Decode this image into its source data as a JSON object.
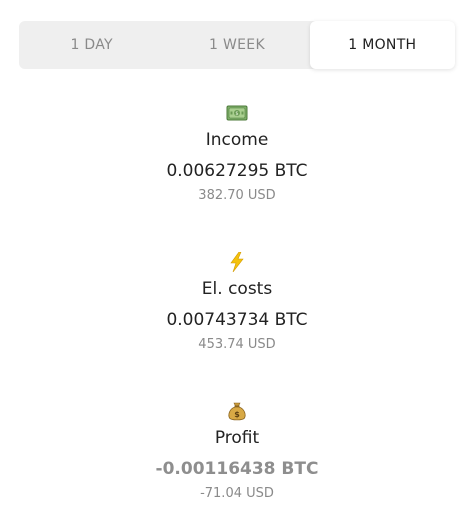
{
  "tabs": [
    {
      "label": "1 DAY",
      "active": false
    },
    {
      "label": "1 WEEK",
      "active": false
    },
    {
      "label": "1 MONTH",
      "active": true
    }
  ],
  "stats": {
    "income": {
      "icon": "money-bills-icon",
      "label": "Income",
      "btc": "0.00627295 BTC",
      "usd": "382.70 USD"
    },
    "costs": {
      "icon": "lightning-icon",
      "label": "El. costs",
      "btc": "0.00743734 BTC",
      "usd": "453.74 USD"
    },
    "profit": {
      "icon": "money-bag-icon",
      "label": "Profit",
      "btc": "-0.00116438 BTC",
      "usd": "-71.04 USD"
    }
  },
  "colors": {
    "tab_bg": "#efefef",
    "active_tab_bg": "#ffffff",
    "text_primary": "#222222",
    "text_secondary": "#8a8a8a"
  }
}
